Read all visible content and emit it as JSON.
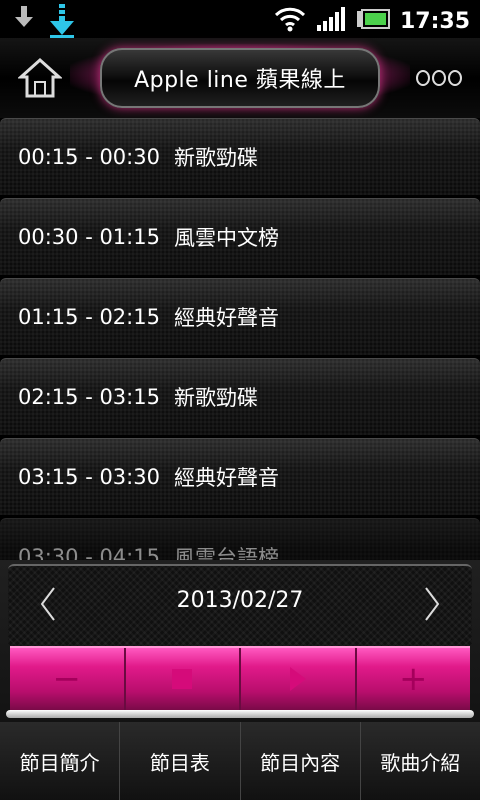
{
  "statusbar": {
    "time": "17:35",
    "icons": [
      "download-arrow-icon",
      "download-animated-icon",
      "wifi-icon",
      "signal-icon",
      "battery-icon"
    ]
  },
  "header": {
    "title": "Apple line 蘋果線上",
    "home_icon": "home-icon",
    "more_icon": "more-dots-icon"
  },
  "schedule": [
    {
      "time": "00:15 - 00:30",
      "program": "新歌勁碟"
    },
    {
      "time": "00:30 - 01:15",
      "program": "風雲中文榜"
    },
    {
      "time": "01:15 - 02:15",
      "program": "經典好聲音"
    },
    {
      "time": "02:15 - 03:15",
      "program": "新歌勁碟"
    },
    {
      "time": "03:15 - 03:30",
      "program": "經典好聲音"
    },
    {
      "time": "03:30 - 04:15",
      "program": "風雲台語榜"
    }
  ],
  "date_nav": {
    "date": "2013/02/27",
    "prev_icon": "chevron-left-icon",
    "next_icon": "chevron-right-icon"
  },
  "controls": [
    {
      "name": "minus",
      "glyph": "−"
    },
    {
      "name": "stop",
      "glyph": ""
    },
    {
      "name": "play",
      "glyph": ""
    },
    {
      "name": "plus",
      "glyph": "+"
    }
  ],
  "tabs": [
    "節目簡介",
    "節目表",
    "節目內容",
    "歌曲介紹"
  ],
  "colors": {
    "accent": "#e11a8a",
    "accent_dark": "#a5005c",
    "battery": "#4cd14c"
  }
}
